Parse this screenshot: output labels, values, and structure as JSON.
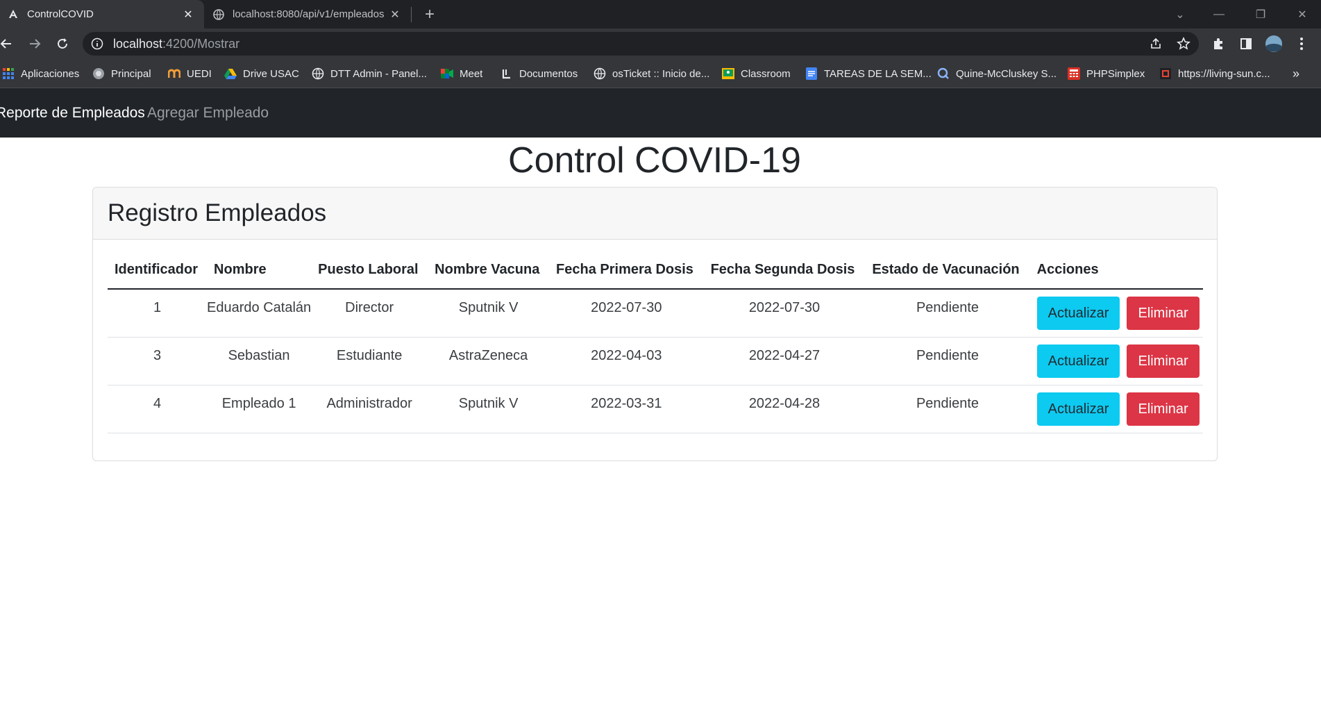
{
  "browser": {
    "tabs": [
      {
        "title": "ControlCOVID",
        "active": true,
        "icon": "angular-icon"
      },
      {
        "title": "localhost:8080/api/v1/empleados",
        "active": false,
        "icon": "globe-icon"
      }
    ],
    "address_bar": {
      "host": "localhost",
      "path": ":4200/Mostrar"
    },
    "bookmarks": [
      {
        "label": "Aplicaciones",
        "icon": "apps-grid-icon"
      },
      {
        "label": "Principal",
        "icon": "globe-icon"
      },
      {
        "label": "UEDI",
        "icon": "uedi-icon"
      },
      {
        "label": "Drive USAC",
        "icon": "drive-icon"
      },
      {
        "label": "DTT Admin - Panel...",
        "icon": "globe-icon"
      },
      {
        "label": "Meet",
        "icon": "meet-icon"
      },
      {
        "label": "Documentos",
        "icon": "docs-icon"
      },
      {
        "label": "osTicket :: Inicio de...",
        "icon": "globe-icon"
      },
      {
        "label": "Classroom",
        "icon": "classroom-icon"
      },
      {
        "label": "TAREAS DE LA SEM...",
        "icon": "document-icon"
      },
      {
        "label": "Quine-McCluskey S...",
        "icon": "q-icon"
      },
      {
        "label": "PHPSimplex",
        "icon": "calculator-icon"
      },
      {
        "label": "https://living-sun.c...",
        "icon": "site-icon"
      }
    ],
    "bookmarks_more": "»"
  },
  "navbar": {
    "links": [
      {
        "label": "Reporte de Empleados",
        "active": true
      },
      {
        "label": "Agregar Empleado",
        "active": false
      }
    ]
  },
  "page": {
    "title": "Control COVID-19",
    "card_title": "Registro Empleados"
  },
  "table": {
    "headers": [
      "Identificador",
      "Nombre",
      "Puesto Laboral",
      "Nombre Vacuna",
      "Fecha Primera Dosis",
      "Fecha Segunda Dosis",
      "Estado de Vacunación",
      "Acciones"
    ],
    "rows": [
      {
        "id": "1",
        "nombre": "Eduardo Catalán",
        "puesto": "Director",
        "vacuna": "Sputnik V",
        "fecha1": "2022-07-30",
        "fecha2": "2022-07-30",
        "estado": "Pendiente"
      },
      {
        "id": "3",
        "nombre": "Sebastian",
        "puesto": "Estudiante",
        "vacuna": "AstraZeneca",
        "fecha1": "2022-04-03",
        "fecha2": "2022-04-27",
        "estado": "Pendiente"
      },
      {
        "id": "4",
        "nombre": "Empleado 1",
        "puesto": "Administrador",
        "vacuna": "Sputnik V",
        "fecha1": "2022-03-31",
        "fecha2": "2022-04-28",
        "estado": "Pendiente"
      }
    ],
    "actions": {
      "update_label": "Actualizar",
      "delete_label": "Eliminar"
    }
  },
  "colors": {
    "navbar_bg": "#212529",
    "btn_info": "#0dcaf0",
    "btn_danger": "#dc3545"
  }
}
